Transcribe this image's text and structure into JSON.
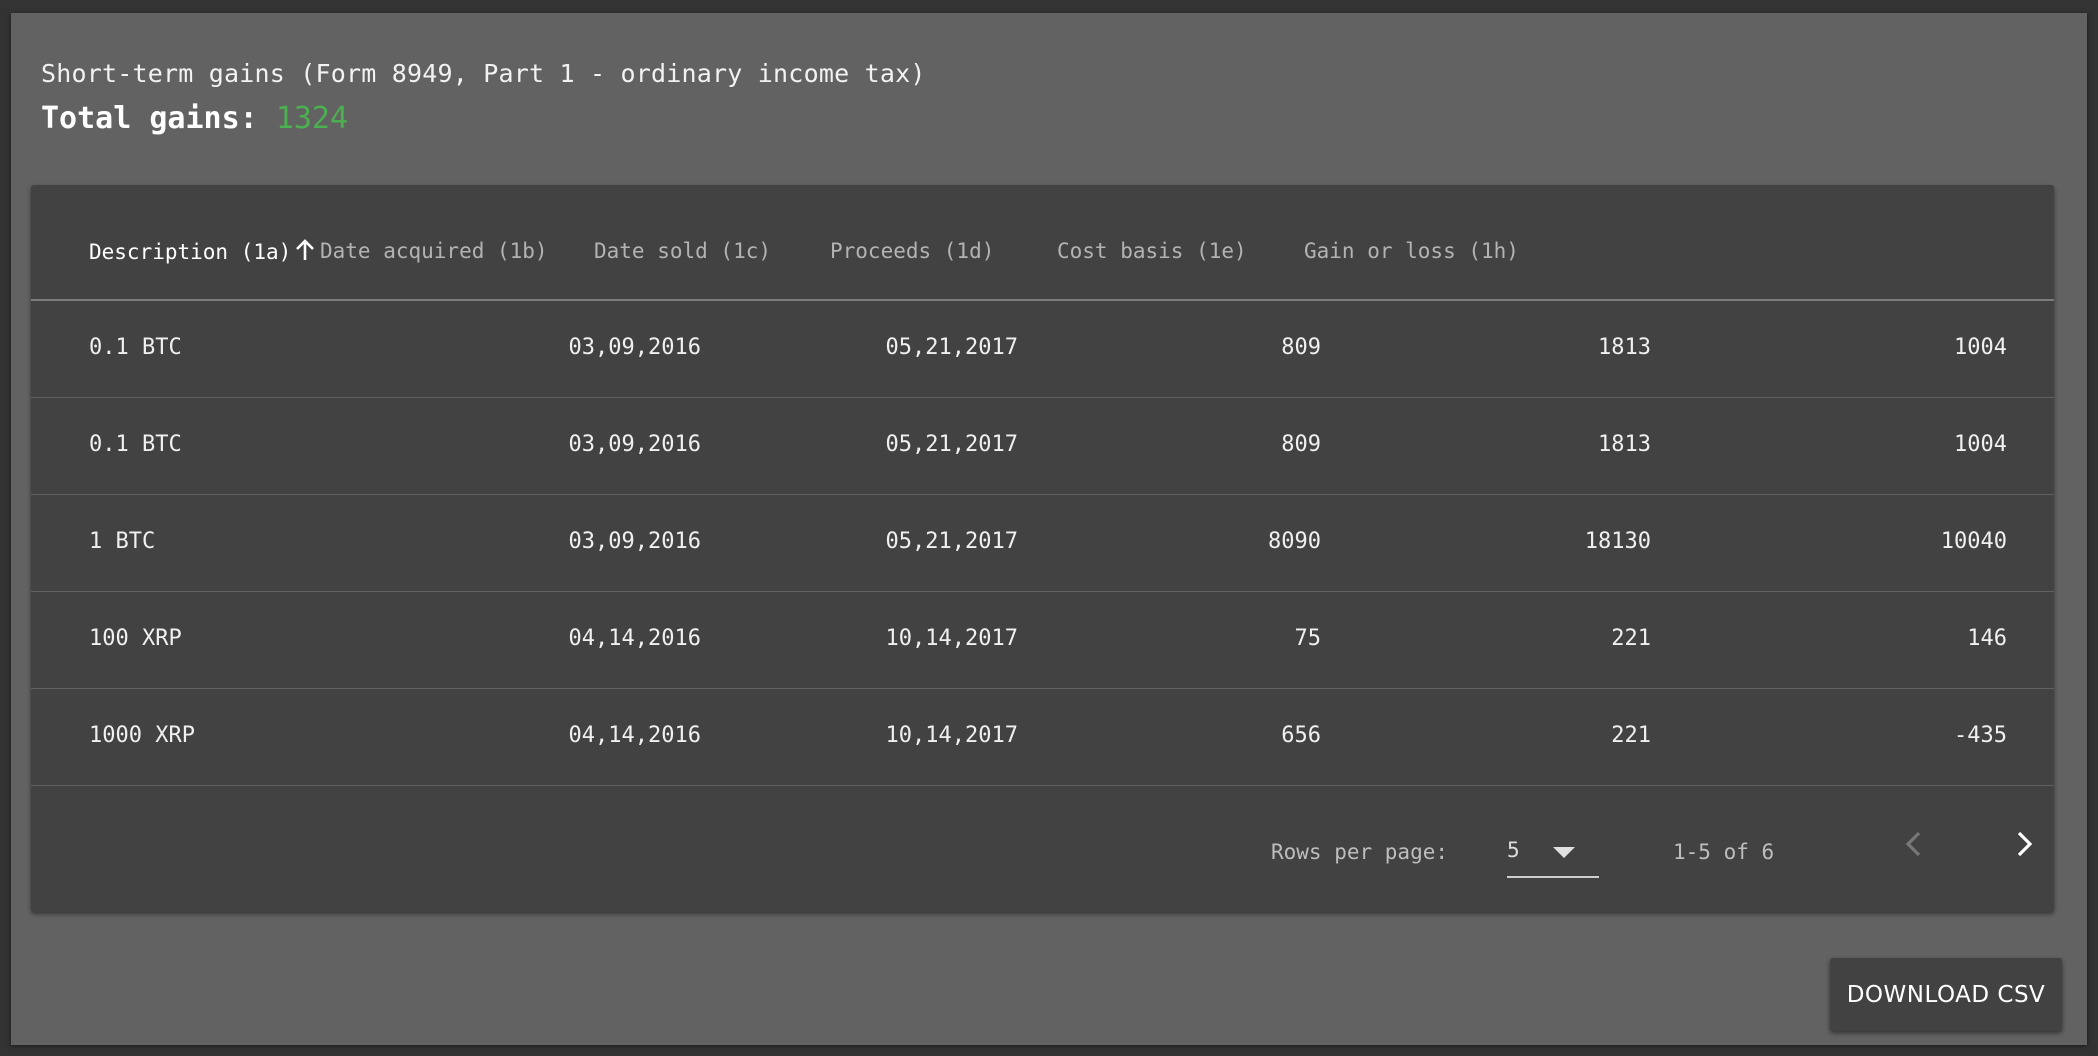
{
  "summary": {
    "heading": "Short-term gains (Form 8949, Part 1 - ordinary income tax)",
    "total_label": "Total gains:",
    "total_value": "1324"
  },
  "table": {
    "columns": [
      "Description (1a)",
      "Date acquired (1b)",
      "Date sold (1c)",
      "Proceeds (1d)",
      "Cost basis (1e)",
      "Gain or loss (1h)"
    ],
    "sort_column": "Description (1a)",
    "sort_direction": "ascending",
    "rows": [
      [
        "0.1 BTC",
        "03,09,2016",
        "05,21,2017",
        "809",
        "1813",
        "1004"
      ],
      [
        "0.1 BTC",
        "03,09,2016",
        "05,21,2017",
        "809",
        "1813",
        "1004"
      ],
      [
        "1 BTC",
        "03,09,2016",
        "05,21,2017",
        "8090",
        "18130",
        "10040"
      ],
      [
        "100 XRP",
        "04,14,2016",
        "10,14,2017",
        "75",
        "221",
        "146"
      ],
      [
        "1000 XRP",
        "04,14,2016",
        "10,14,2017",
        "656",
        "221",
        "-435"
      ]
    ]
  },
  "pagination": {
    "rows_per_page_label": "Rows per page:",
    "rows_per_page_value": "5",
    "range_text": "1-5 of 6",
    "prev_icon": "chevron-left-icon",
    "next_icon": "chevron-right-icon"
  },
  "actions": {
    "download_label": "DOWNLOAD CSV"
  },
  "colors": {
    "panel_bg": "#626262",
    "card_bg": "#424242",
    "gain_positive": "#4caf50"
  }
}
